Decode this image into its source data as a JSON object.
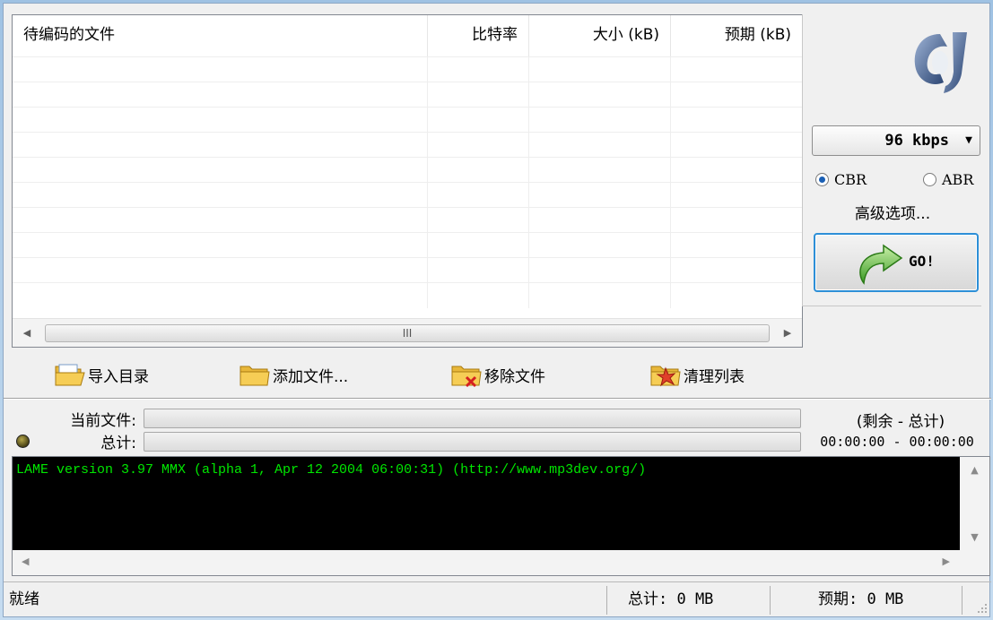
{
  "file_list": {
    "columns": [
      "待编码的文件",
      "比特率",
      "大小 (kB)",
      "预期 (kB)"
    ],
    "rows": [],
    "scroll_grip": "III"
  },
  "settings": {
    "bitrate": "96 kbps",
    "mode_cbr": "CBR",
    "mode_abr": "ABR",
    "selected_mode": "CBR",
    "advanced": "高级选项...",
    "go": "GO!"
  },
  "toolbar": {
    "import_dir": "导入目录",
    "add_files": "添加文件...",
    "remove_files": "移除文件",
    "clear_list": "清理列表"
  },
  "progress": {
    "current_file_label": "当前文件:",
    "total_label": "总计:",
    "remaining_label": "(剩余 - 总计)",
    "times": "00:00:00 - 00:00:00",
    "current_fraction": 0,
    "total_fraction": 0
  },
  "log": {
    "lines": [
      "LAME version 3.97 MMX (alpha 1, Apr 12 2004 06:00:31) (http://www.mp3dev.org/)"
    ]
  },
  "status": {
    "ready": "就绪",
    "total": "总计: 0 MB",
    "expected": "预期: 0 MB"
  },
  "icons": [
    "app-logo-icon",
    "folder-open-icon",
    "folder-icon",
    "folder-remove-icon",
    "clear-list-icon",
    "go-arrow-icon",
    "status-led-icon",
    "dropdown-arrow-icon",
    "size-grip-icon"
  ],
  "colors": {
    "log_bg": "#000000",
    "log_text": "#00e600",
    "go_border": "#2d8fd7"
  }
}
